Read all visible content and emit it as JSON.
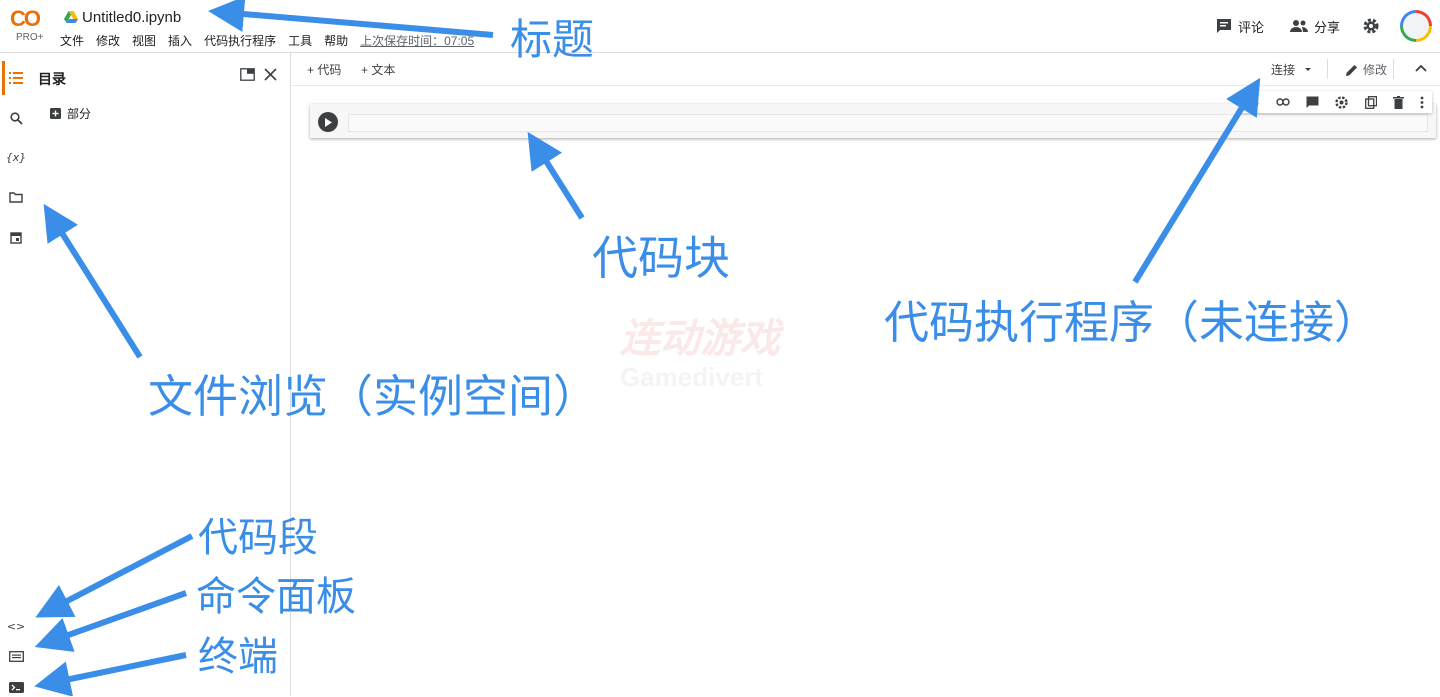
{
  "header": {
    "logo_text": "CO",
    "logo_badge": "PRO+",
    "doc_title": "Untitled0.ipynb",
    "menu": [
      "文件",
      "修改",
      "视图",
      "插入",
      "代码执行程序",
      "工具",
      "帮助"
    ],
    "saved_text": "上次保存时间：07:05",
    "comment_label": "评论",
    "share_label": "分享"
  },
  "toc": {
    "title": "目录",
    "section_label": "部分"
  },
  "toolbar": {
    "add_code": "+ 代码",
    "add_text": "+ 文本",
    "connect": "连接",
    "edit": "修改"
  },
  "watermark": {
    "line1": "连动游戏",
    "line2": "Gamedivert"
  },
  "annotations": {
    "title": "标题",
    "code_cell": "代码块",
    "runtime": "代码执行程序（未连接）",
    "file_browser": "文件浏览（实例空间）",
    "snippets": "代码段",
    "command_palette": "命令面板",
    "terminal": "终端"
  },
  "colors": {
    "annotation": "#3a8ee8",
    "accent": "#e8710a",
    "logo_yellow": "#f9ab00"
  },
  "icons": [
    "drive-icon",
    "comment-icon",
    "people-icon",
    "gear-icon",
    "toc-icon",
    "search-icon",
    "variables-icon",
    "folder-icon",
    "calendar-icon",
    "code-icon",
    "command-icon",
    "terminal-icon",
    "open-tab-icon",
    "close-icon",
    "pencil-icon",
    "chevron-up-icon",
    "run-icon"
  ]
}
